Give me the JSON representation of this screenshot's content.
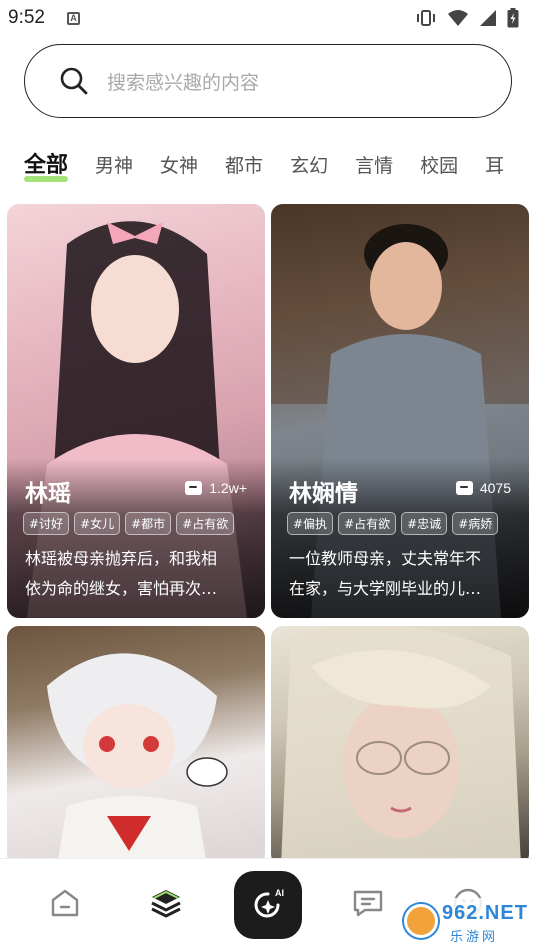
{
  "status_bar": {
    "time": "9:52",
    "notification_icon": "a-icon",
    "right_icons": [
      "vibrate-icon",
      "wifi-icon",
      "signal-icon",
      "battery-icon"
    ]
  },
  "search": {
    "placeholder": "搜索感兴趣的内容",
    "icon": "search-icon"
  },
  "tabs": [
    {
      "label": "全部",
      "active": true
    },
    {
      "label": "男神",
      "active": false
    },
    {
      "label": "女神",
      "active": false
    },
    {
      "label": "都市",
      "active": false
    },
    {
      "label": "玄幻",
      "active": false
    },
    {
      "label": "言情",
      "active": false
    },
    {
      "label": "校园",
      "active": false
    },
    {
      "label": "耳",
      "active": false
    }
  ],
  "accent_color": "#9be06a",
  "cards": [
    {
      "name": "林瑶",
      "chat_count": "1.2w+",
      "tags": [
        "#讨好",
        "#女儿",
        "#都市",
        "#占有欲"
      ],
      "description_line1": "林瑶被母亲抛弃后，和我相",
      "description_line2": "依为命的继女，害怕再次…"
    },
    {
      "name": "林娴情",
      "chat_count": "4075",
      "tags": [
        "#偏执",
        "#占有欲",
        "#忠诚",
        "#病娇"
      ],
      "description_line1": "一位教师母亲，丈夫常年不",
      "description_line2": "在家，与大学刚毕业的儿…"
    }
  ],
  "bottom_nav": {
    "items": [
      "home-icon",
      "layers-icon",
      "ai-icon",
      "message-icon",
      "profile-icon"
    ],
    "ai_label": "AI"
  },
  "watermark": {
    "text": "962.NET",
    "sub": "乐游网"
  }
}
